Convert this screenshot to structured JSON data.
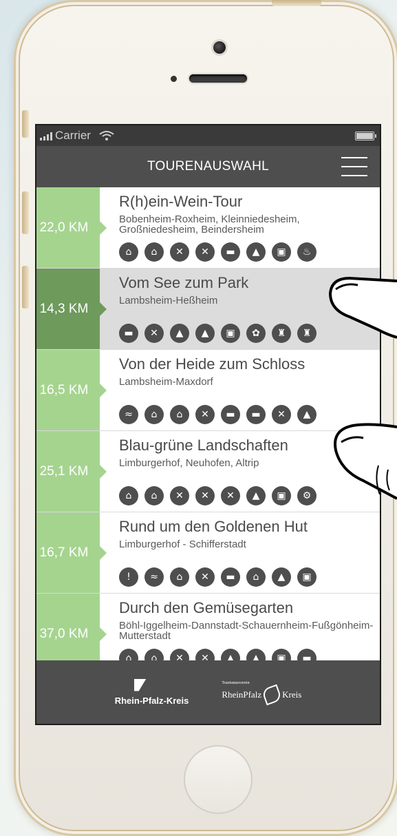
{
  "status_bar": {
    "carrier": "Carrier"
  },
  "nav": {
    "title": "TOURENAUSWAHL"
  },
  "tours": [
    {
      "km": "22,0 KM",
      "title": "R(h)ein-Wein-Tour",
      "subtitle": "Bobenheim-Roxheim, Kleinniedesheim, Großniedesheim, Beindersheim",
      "icons": [
        "museum-icon",
        "museum-icon",
        "restaurant-icon",
        "restaurant-icon",
        "hotel-icon",
        "shopping-icon",
        "train-icon",
        "campfire-icon"
      ]
    },
    {
      "km": "14,3 KM",
      "title": "Vom See zum Park",
      "subtitle": "Lambsheim-Heßheim",
      "selected": true,
      "icons": [
        "hotel-icon",
        "restaurant-icon",
        "shopping-icon",
        "shopping-icon",
        "train-icon",
        "bird-icon",
        "tower-icon",
        "tower-icon"
      ]
    },
    {
      "km": "16,5 KM",
      "title": "Von der Heide zum Schloss",
      "subtitle": "Lambsheim-Maxdorf",
      "icons": [
        "swimming-icon",
        "museum-icon",
        "museum-icon",
        "restaurant-icon",
        "hotel-icon",
        "hotel-icon",
        "restaurant-icon",
        "shopping-icon"
      ]
    },
    {
      "km": "25,1 KM",
      "title": "Blau-grüne Landschaften",
      "subtitle": "Limburgerhof, Neuhofen, Altrip",
      "icons": [
        "museum-icon",
        "museum-icon",
        "restaurant-icon",
        "restaurant-icon",
        "restaurant-icon",
        "shopping-icon",
        "train-icon",
        "bicycle-icon"
      ]
    },
    {
      "km": "16,7 KM",
      "title": "Rund um den Goldenen Hut",
      "subtitle": "Limburgerhof - Schifferstadt",
      "icons": [
        "info-icon",
        "swimming-icon",
        "museum-icon",
        "restaurant-icon",
        "hotel-icon",
        "museum-icon",
        "shopping-icon",
        "train-icon"
      ]
    },
    {
      "km": "37,0 KM",
      "title": "Durch den Gemüsegarten",
      "subtitle": "Böhl-Iggelheim-Dannstadt-Schauernheim-Fußgönheim-Mutterstadt",
      "icons": [
        "museum-icon",
        "museum-icon",
        "restaurant-icon",
        "restaurant-icon",
        "shopping-icon",
        "shopping-icon",
        "train-icon",
        "hotel-icon"
      ]
    }
  ],
  "footer": {
    "logo1": "Rhein-Pfalz-Kreis",
    "logo2_small": "Tourismusverein",
    "logo2_a": "RheinPfalz",
    "logo2_b": "Kreis"
  }
}
